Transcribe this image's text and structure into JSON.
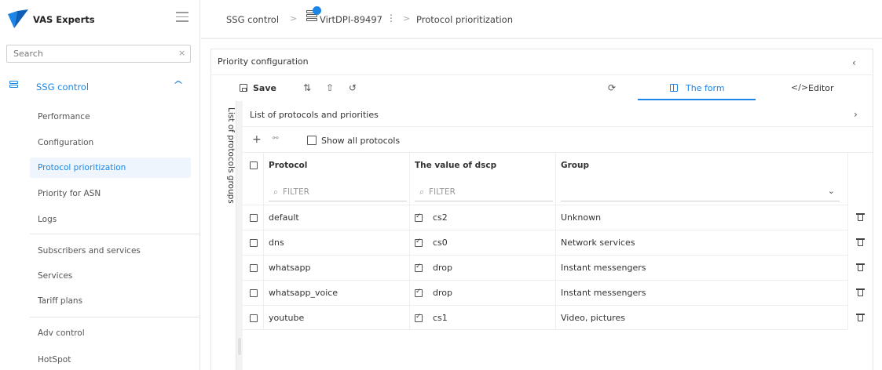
{
  "app": {
    "brand": "VAS Experts"
  },
  "sidebar": {
    "search_placeholder": "Search",
    "search_clear": "×",
    "section": {
      "label": "SSG control",
      "expanded": true
    },
    "items": [
      {
        "label": "Performance",
        "active": false
      },
      {
        "label": "Configuration",
        "active": false
      },
      {
        "label": "Protocol prioritization",
        "active": true
      },
      {
        "label": "Priority for ASN",
        "active": false
      },
      {
        "label": "Logs",
        "active": false
      },
      {
        "label": "Subscribers and services",
        "active": false
      },
      {
        "label": "Services",
        "active": false
      },
      {
        "label": "Tariff plans",
        "active": false
      },
      {
        "label": "Adv control",
        "active": false
      },
      {
        "label": "HotSpot",
        "active": false
      }
    ]
  },
  "breadcrumb": {
    "items": [
      "SSG control",
      "VirtDPI-89497",
      "Protocol prioritization"
    ],
    "separator": ">"
  },
  "panel": {
    "title": "Priority configuration",
    "toolbar": {
      "save_label": "Save"
    },
    "tabs": [
      {
        "label": "The form",
        "active": true
      },
      {
        "label": "Editor",
        "active": false
      }
    ],
    "vertical_tab_label": "List of protocols groups"
  },
  "list": {
    "title": "List of protocols and priorities",
    "show_all_label": "Show all protocols",
    "show_all_checked": false,
    "columns": [
      "Protocol",
      "The value of dscp",
      "Group"
    ],
    "filter_placeholder": "FILTER",
    "rows": [
      {
        "protocol": "default",
        "dscp": "cs2",
        "group": "Unknown"
      },
      {
        "protocol": "dns",
        "dscp": "cs0",
        "group": "Network services"
      },
      {
        "protocol": "whatsapp",
        "dscp": "drop",
        "group": "Instant messengers"
      },
      {
        "protocol": "whatsapp_voice",
        "dscp": "drop",
        "group": "Instant messengers"
      },
      {
        "protocol": "youtube",
        "dscp": "cs1",
        "group": "Video, pictures"
      }
    ]
  },
  "colors": {
    "accent": "#1c86e6",
    "active_item_bg": "#eef5fd"
  }
}
